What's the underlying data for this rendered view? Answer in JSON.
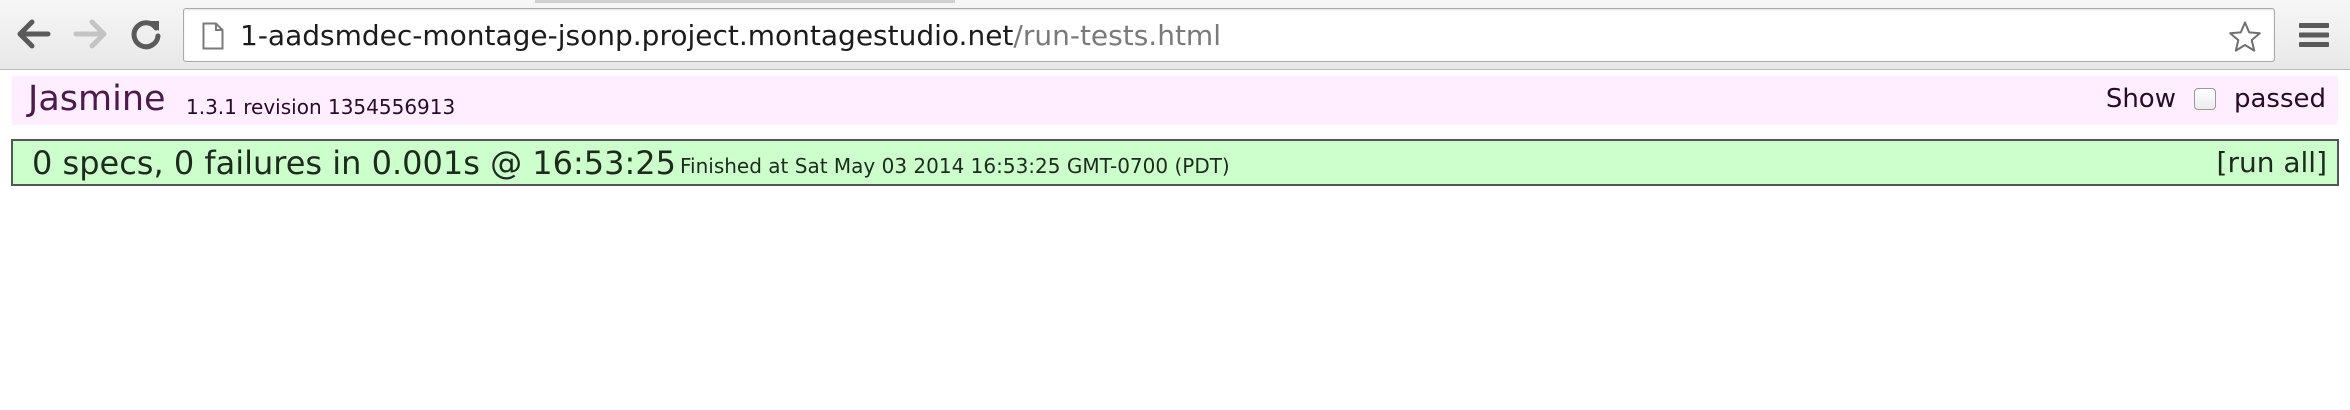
{
  "browser": {
    "url_host": "1-aadsmdec-montage-jsonp.project.montagestudio.net",
    "url_path": "/run-tests.html",
    "icons": {
      "back": "back-arrow-icon",
      "forward": "forward-arrow-icon",
      "reload": "reload-icon",
      "page": "page-icon",
      "star": "star-icon",
      "menu": "hamburger-menu-icon"
    }
  },
  "jasmine": {
    "title": "Jasmine",
    "version": "1.3.1 revision 1354556913",
    "show_label": "Show",
    "passed_label": "passed",
    "passed_checked": false,
    "summary": "0 specs, 0 failures in 0.001s @ 16:53:25",
    "finished": "Finished at Sat May 03 2014 16:53:25 GMT-0700 (PDT)",
    "run_all": "[run all]",
    "colors": {
      "banner_bg": "#ffeeff",
      "title": "#4c1b4c",
      "summary_bg": "#ccffcc",
      "summary_border": "#555555"
    }
  }
}
